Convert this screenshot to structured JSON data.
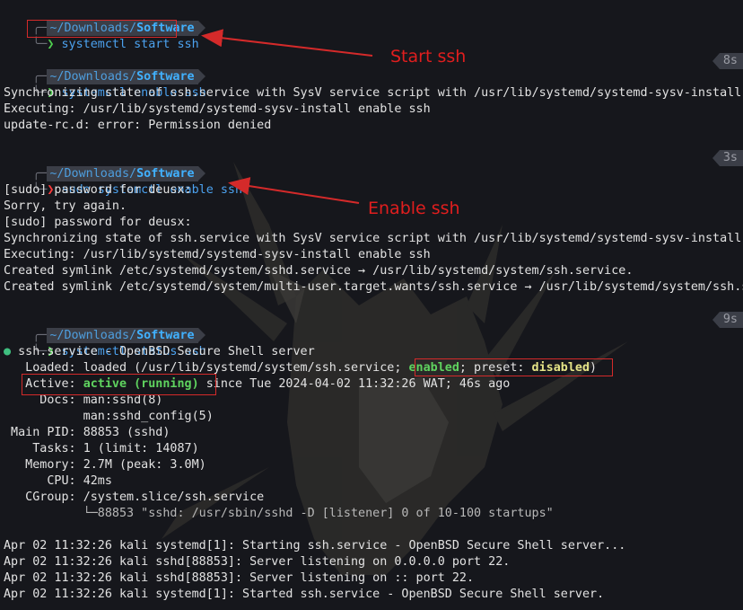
{
  "prompt": {
    "path_prefix": "~/Downloads/",
    "path_dir": "Software",
    "corner_top": "╭─",
    "corner_bottom": "╰─",
    "chevron": "❯"
  },
  "blocks": [
    {
      "command": "systemctl start ssh",
      "status": "ok",
      "elapsed": "",
      "output": []
    },
    {
      "command": "systemctl enable ssh",
      "status": "ok",
      "elapsed": "8s",
      "output": [
        "Synchronizing state of ssh.service with SysV service script with /usr/lib/systemd/systemd-sysv-install.",
        "Executing: /usr/lib/systemd/systemd-sysv-install enable ssh",
        "update-rc.d: error: Permission denied"
      ]
    },
    {
      "command": "sudo systemctl enable ssh",
      "status": "error",
      "elapsed": "3s",
      "output": [
        "[sudo] password for deusx:",
        "Sorry, try again.",
        "[sudo] password for deusx:",
        "Synchronizing state of ssh.service with SysV service script with /usr/lib/systemd/systemd-sysv-install.",
        "Executing: /usr/lib/systemd/systemd-sysv-install enable ssh",
        "Created symlink /etc/systemd/system/sshd.service → /usr/lib/systemd/system/ssh.service.",
        "Created symlink /etc/systemd/system/multi-user.target.wants/ssh.service → /usr/lib/systemd/system/ssh.s"
      ]
    },
    {
      "command": "systemctl status ssh",
      "status": "ok",
      "elapsed": "9s",
      "output": []
    }
  ],
  "status_output": {
    "bullet": "●",
    "service_line": "ssh.service - OpenBSD Secure Shell server",
    "loaded_label": "   Loaded:",
    "loaded_value": "loaded (/usr/lib/systemd/system/ssh.service;",
    "loaded_enabled": "enabled",
    "loaded_preset": "; preset:",
    "loaded_disabled": "disabled",
    "loaded_close": ")",
    "active_label": "   Active:",
    "active_value": "active (running)",
    "active_since": "since Tue 2024-04-02 11:32:26 WAT; 46s ago",
    "docs_label": "     Docs:",
    "docs_1": "man:sshd(8)",
    "docs_2": "           man:sshd_config(5)",
    "mainpid_label": " Main PID:",
    "mainpid_value": "88853 (sshd)",
    "tasks_label": "    Tasks:",
    "tasks_value": "1 (limit: 14087)",
    "memory_label": "   Memory:",
    "memory_value": "2.7M (peak: 3.0M)",
    "cpu_label": "      CPU:",
    "cpu_value": "42ms",
    "cgroup_label": "   CGroup:",
    "cgroup_value": "/system.slice/ssh.service",
    "cgroup_child": "           └─88853 \"sshd: /usr/sbin/sshd -D [listener] 0 of 10-100 startups\"",
    "logs": [
      "Apr 02 11:32:26 kali systemd[1]: Starting ssh.service - OpenBSD Secure Shell server...",
      "Apr 02 11:32:26 kali sshd[88853]: Server listening on 0.0.0.0 port 22.",
      "Apr 02 11:32:26 kali sshd[88853]: Server listening on :: port 22.",
      "Apr 02 11:32:26 kali systemd[1]: Started ssh.service - OpenBSD Secure Shell server."
    ]
  },
  "annotations": {
    "start_label": "Start ssh",
    "enable_label": "Enable ssh"
  },
  "colors": {
    "background": "#16171c",
    "annotation_red": "#d42a2a",
    "command_blue": "#4ca2ef",
    "ok_green": "#4fd04f",
    "error_red": "#ff3b3b"
  }
}
